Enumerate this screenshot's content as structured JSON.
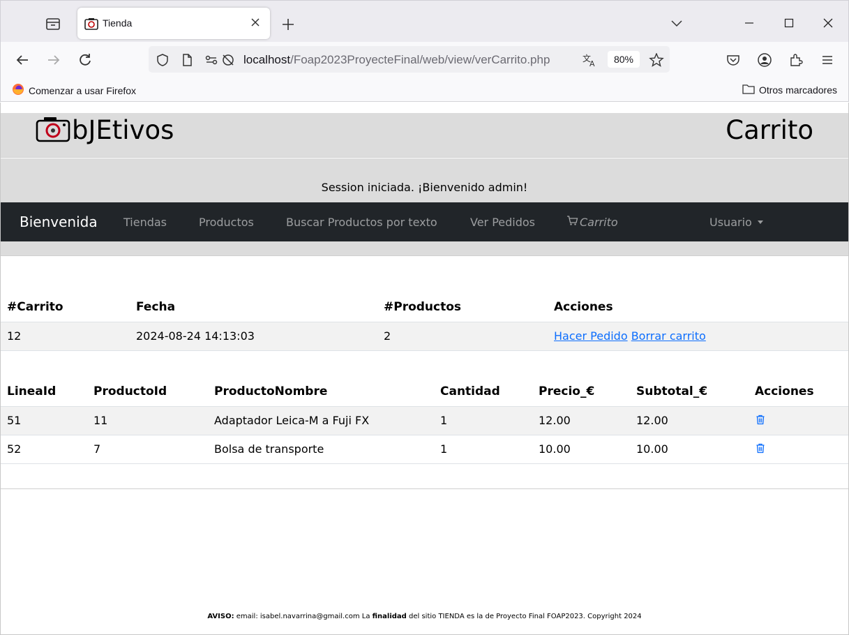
{
  "browser": {
    "tab_title": "Tienda",
    "url_host": "localhost",
    "url_path": "/Foap2023ProyecteFinal/web/view/verCarrito.php",
    "zoom": "80%",
    "bookmark_left": "Comenzar a usar Firefox",
    "bookmark_right": "Otros marcadores"
  },
  "header": {
    "logo_text": "bJEtivos",
    "page_title": "Carrito",
    "session_message": "Session iniciada. ¡Bienvenido admin!"
  },
  "nav": {
    "brand": "Bienvenida",
    "links": [
      "Tiendas",
      "Productos",
      "Buscar Productos por texto",
      "Ver Pedidos"
    ],
    "cart": "Carrito",
    "user": "Usuario"
  },
  "cart_table": {
    "headers": [
      "#Carrito",
      "Fecha",
      "#Productos",
      "Acciones"
    ],
    "row": {
      "id": "12",
      "date": "2024-08-24 14:13:03",
      "count": "2",
      "action_order": "Hacer Pedido",
      "action_delete": "Borrar carrito"
    }
  },
  "lines_table": {
    "headers": [
      "LineaId",
      "ProductoId",
      "ProductoNombre",
      "Cantidad",
      "Precio_€",
      "Subtotal_€",
      "Acciones"
    ],
    "rows": [
      {
        "linea": "51",
        "producto": "11",
        "nombre": "Adaptador Leica-M a Fuji FX",
        "cantidad": "1",
        "precio": "12.00",
        "subtotal": "12.00"
      },
      {
        "linea": "52",
        "producto": "7",
        "nombre": "Bolsa de transporte",
        "cantidad": "1",
        "precio": "10.00",
        "subtotal": "10.00"
      }
    ]
  },
  "footer": {
    "aviso_label": "AVISO:",
    "text_1": " email: isabel.navarrina@gmail.com La ",
    "finalidad": "finalidad",
    "text_2": " del sitio TIENDA es la de Proyecto Final FOAP2023. Copyright 2024"
  },
  "colors": {
    "navbar_bg": "#212529",
    "header_bg": "#dcdcdc",
    "link": "#0d6efd"
  }
}
